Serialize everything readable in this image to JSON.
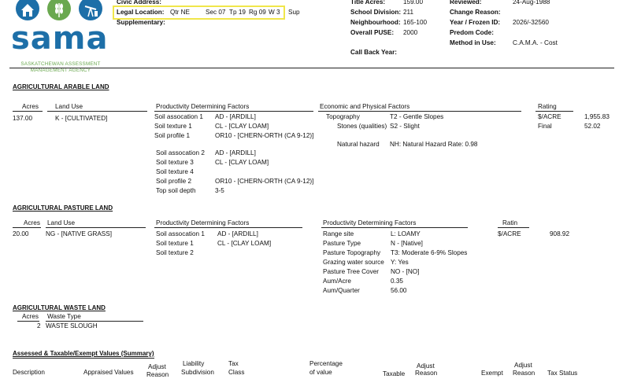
{
  "logo": {
    "wordmark": "sama",
    "line1": "SASKATCHEWAN ASSESSMENT",
    "line2": "MANAGEMENT AGENCY"
  },
  "header": {
    "civic_label": "Civic Address:",
    "legal_label": "Legal Location:",
    "legal_qtr": "Qtr NE",
    "legal_sec": "Sec 07",
    "legal_tp": "Tp 19",
    "legal_rg": "Rg 09",
    "legal_w": "W 3",
    "legal_sup": "Sup",
    "supplementary_label": "Supplementary:",
    "title_acres_label": "Title Acres:",
    "title_acres_value": "159.00",
    "school_label": "School Division:",
    "school_value": "211",
    "neigh_label": "Neighbourhood:",
    "neigh_value": "165-100",
    "puse_label": "Overall PUSE:",
    "puse_value": "2000",
    "callback_label": "Call Back Year:",
    "reviewed_label": "Reviewed:",
    "reviewed_value": "24-Aug-1988",
    "change_label": "Change Reason:",
    "year_label": "Year / Frozen ID:",
    "year_value": "2026/-32560",
    "predom_label": "Predom Code:",
    "method_label": "Method in Use:",
    "method_value": "C.A.M.A. - Cost"
  },
  "arable": {
    "title": "AGRICULTURAL ARABLE LAND",
    "col_acres": "Acres",
    "col_landuse": "Land Use",
    "col_pdf": "Productivity Determining Factors",
    "col_econ": "Economic and Physical Factors",
    "col_rating": "Rating",
    "acres": "137.00",
    "landuse": "K - [CULTIVATED]",
    "pdf1": [
      {
        "label": "Soil assocation 1",
        "value": "AD - [ARDILL]"
      },
      {
        "label": "Soil texture 1",
        "value": "CL - [CLAY LOAM]"
      },
      {
        "label": "Soil profile 1",
        "value": "OR10 - [CHERN-ORTH (CA 9-12)]"
      }
    ],
    "pdf2": [
      {
        "label": "Soil assocation 2",
        "value": "AD - [ARDILL]"
      },
      {
        "label": "Soil texture 3",
        "value": "CL - [CLAY LOAM]"
      },
      {
        "label": "Soil texture 4",
        "value": ""
      },
      {
        "label": "Soil profile 2",
        "value": "OR10 - [CHERN-ORTH (CA 9-12)]"
      },
      {
        "label": "Top soil depth",
        "value": "3-5"
      }
    ],
    "econ": [
      {
        "label": "Topography",
        "value": "T2 - Gentle Slopes"
      },
      {
        "label": "Stones (qualities)",
        "value": "S2 - Slight"
      }
    ],
    "hazard_label": "Natural hazard",
    "hazard_value": "NH: Natural Hazard Rate: 0.98",
    "rating_acre_label": "$/ACRE",
    "rating_acre_value": "1,955.83",
    "rating_final_label": "Final",
    "rating_final_value": "52.02"
  },
  "pasture": {
    "title": "AGRICULTURAL PASTURE LAND",
    "col_acres": "Acres",
    "col_landuse": "Land Use",
    "col_pdf": "Productivity Determining Factors",
    "col_pdf2": "Productivity Determining Factors",
    "col_rating": "Ratin",
    "acres": "20.00",
    "landuse": "NG - [NATIVE GRASS]",
    "soil": [
      {
        "label": "Soil assocation 1",
        "value": "AD - [ARDILL]"
      },
      {
        "label": "Soil texture 1",
        "value": "CL - [CLAY LOAM]"
      },
      {
        "label": "Soil texture 2",
        "value": ""
      }
    ],
    "factors": [
      {
        "label": "Range site",
        "value": "L: LOAMY"
      },
      {
        "label": "Pasture Type",
        "value": "N - [Native]"
      },
      {
        "label": "Pasture Topography",
        "value": "T3: Moderate 6-9% Slopes"
      },
      {
        "label": "Grazing water source",
        "value": "Y: Yes"
      },
      {
        "label": "Pasture Tree Cover",
        "value": "NO - [NO]"
      },
      {
        "label": "Aum/Acre",
        "value": "0.35"
      },
      {
        "label": "Aum/Quarter",
        "value": "56.00"
      }
    ],
    "rating_label": "$/ACRE",
    "rating_value": "908.92"
  },
  "waste": {
    "title": "AGRICULTURAL WASTE LAND",
    "col_acres": "Acres",
    "col_type": "Waste Type",
    "acres": "2",
    "type": "WASTE SLOUGH"
  },
  "assessed": {
    "title": "Assessed & Taxable/Exempt Values (Summary)",
    "cols": {
      "description": "Description",
      "appraised": "Appraised Values",
      "adjust1_a": "Adjust",
      "adjust1_b": "Reason",
      "liability_a": "Liability",
      "liability_b": "Subdivision",
      "tax_a": "Tax",
      "tax_b": "Class",
      "pct_a": "Percentage",
      "pct_b": "of value",
      "taxable": "Taxable",
      "adjust2_a": "Adjust",
      "adjust2_b": "Reason",
      "exempt": "Exempt",
      "adjust3_a": "Adjust",
      "adjust3_b": "Reason",
      "status": "Tax Status"
    }
  },
  "colors": {
    "logo_blue": "#1d6fa8",
    "logo_green": "#6aa84f",
    "highlight": "#f0e64a"
  }
}
